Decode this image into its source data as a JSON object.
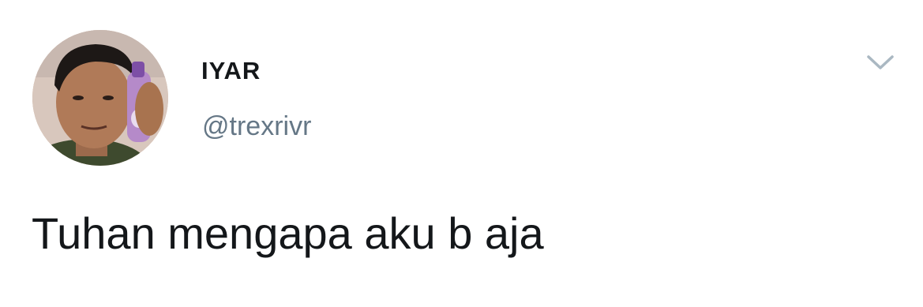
{
  "tweet": {
    "author": {
      "display_name": "IYAR",
      "handle": "@trexrivr"
    },
    "text": "Tuhan mengapa aku b aja",
    "menu_icon": "chevron-down-icon"
  },
  "colors": {
    "background": "#ffffff",
    "name": "#14171a",
    "handle": "#657786",
    "caret": "#aab8c2"
  }
}
